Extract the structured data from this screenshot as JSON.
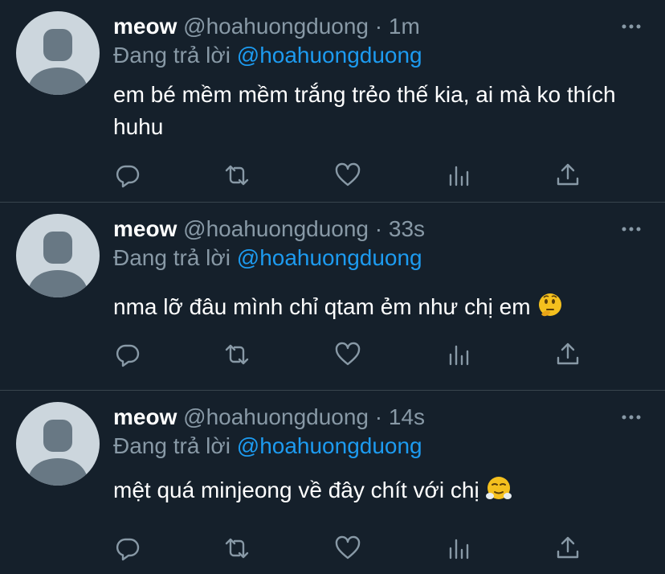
{
  "tweets": [
    {
      "name": "meow",
      "handle": "@hoahuongduong",
      "time": "· 1m",
      "reply_prefix": "Đang trả lời",
      "reply_to": "@hoahuongduong",
      "text": "em bé mềm mềm trắng trẻo thế kia, ai mà ko thích huhu",
      "emoji": ""
    },
    {
      "name": "meow",
      "handle": "@hoahuongduong",
      "time": "· 33s",
      "reply_prefix": "Đang trả lời",
      "reply_to": "@hoahuongduong",
      "text": "nma lỡ đâu mình chỉ qtam ẻm như chị em",
      "emoji": "thinking-face"
    },
    {
      "name": "meow",
      "handle": "@hoahuongduong",
      "time": "· 14s",
      "reply_prefix": "Đang trả lời",
      "reply_to": "@hoahuongduong",
      "text": "mệt quá minjeong về đây chít với chị",
      "emoji": "face-with-steam-from-nose"
    }
  ],
  "colors": {
    "background": "#15202b",
    "divider": "#38444d",
    "secondary_text": "#8899a6",
    "mention": "#1d9bf0",
    "avatar_bg": "#ccd6dd",
    "avatar_figure": "#687884"
  }
}
